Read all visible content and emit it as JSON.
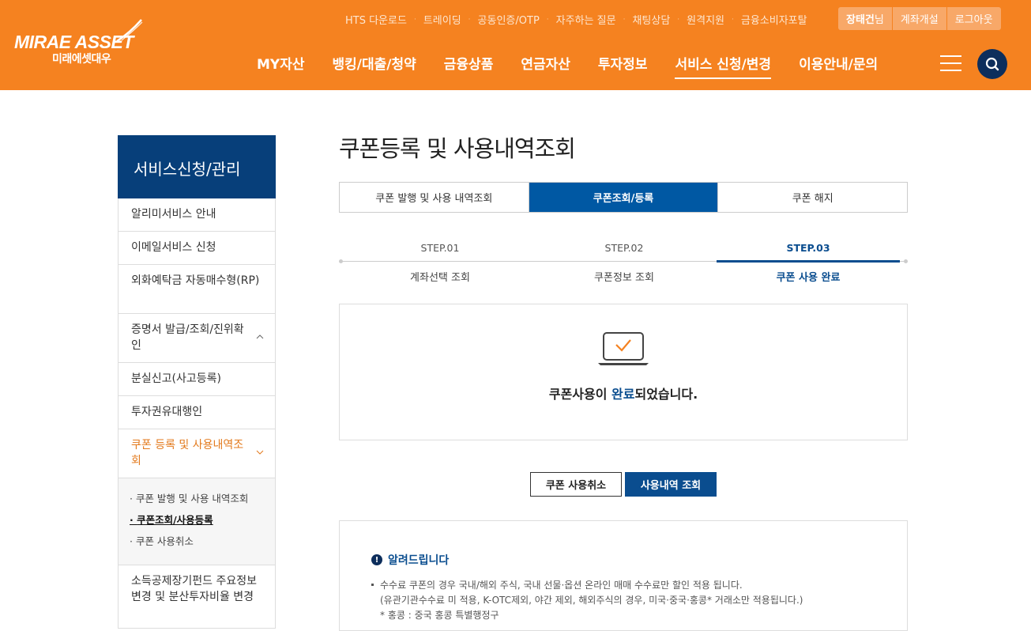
{
  "header": {
    "logo_en": "MIRAE ASSET",
    "logo_ko": "미래에셋대우",
    "util_links": [
      "HTS 다운로드",
      "트레이딩",
      "공동인증/OTP",
      "자주하는 질문",
      "채팅상담",
      "원격지원",
      "금융소비자포탈"
    ],
    "user_name": "장태건",
    "user_suffix": "님",
    "open_account": "계좌개설",
    "logout": "로그아웃",
    "nav": [
      "MY자산",
      "뱅킹/대출/청약",
      "금융상품",
      "연금자산",
      "투자정보",
      "서비스 신청/변경",
      "이용안내/문의"
    ],
    "active_nav": "서비스 신청/변경",
    "brand_color": "#f58220"
  },
  "sidebar": {
    "title": "서비스신청/관리",
    "items": [
      "알리미서비스 안내",
      "이메일서비스 신청",
      "외화예탁금 자동매수형(RP)",
      "증명서 발급/조회/진위확인",
      "분실신고(사고등록)",
      "투자권유대행인",
      "쿠폰 등록 및 사용내역조회",
      "소득공제장기펀드 주요정보변경 및 분산투자비율 변경"
    ],
    "sub_items": [
      "쿠폰 발행 및 사용 내역조회",
      "쿠폰조회/사용등록",
      "쿠폰 사용취소"
    ]
  },
  "main": {
    "title": "쿠폰등록 및 사용내역조회",
    "tabs": [
      "쿠폰 발행 및 사용 내역조회",
      "쿠폰조회/등록",
      "쿠폰 해지"
    ],
    "steps": [
      {
        "num": "STEP.01",
        "label": "계좌선택 조회"
      },
      {
        "num": "STEP.02",
        "label": "쿠폰정보 조회"
      },
      {
        "num": "STEP.03",
        "label": "쿠폰 사용 완료"
      }
    ],
    "result": {
      "pre": "쿠폰사용이 ",
      "highlight": "완료",
      "post": "되었습니다."
    },
    "cancel_button": "쿠폰 사용취소",
    "history_button": "사용내역 조회",
    "notice": {
      "title": "알려드립니다",
      "line1": "수수료 쿠폰의 경우 국내/해외 주식, 국내 선물·옵션 온라인 매매 수수료만 할인 적용 됩니다.",
      "line2": "(유관기관수수료 미 적용, K-OTC제외, 야간 제외, 해외주식의 경우, 미국·중국·홍콩* 거래소만 적용됩니다.)",
      "line3": "* 홍콩 : 중국 홍콩 특별행정구"
    }
  }
}
